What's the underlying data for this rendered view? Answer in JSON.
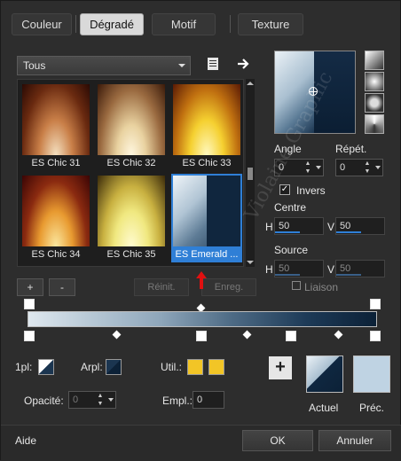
{
  "tabs": [
    {
      "label": "Couleur"
    },
    {
      "label": "Dégradé"
    },
    {
      "label": "Motif"
    },
    {
      "label": "Texture"
    }
  ],
  "category": {
    "selected": "Tous"
  },
  "gradients": [
    {
      "label": "ES Chic 31"
    },
    {
      "label": "ES Chic 32"
    },
    {
      "label": "ES Chic 33"
    },
    {
      "label": "ES Chic 34"
    },
    {
      "label": "ES Chic 35"
    },
    {
      "label": "ES Emerald ..."
    }
  ],
  "list_buttons": {
    "add": "+",
    "remove": "-",
    "reset": "Réinit.",
    "save": "Enreg."
  },
  "params": {
    "angle_label": "Angle",
    "angle_value": "0",
    "repeat_label": "Répét.",
    "repeat_value": "0",
    "invert_label": "Invers",
    "invert_checked": true,
    "centre_label": "Centre",
    "centre_h_label": "H",
    "centre_h": "50",
    "centre_v_label": "V",
    "centre_v": "50",
    "source_label": "Source",
    "source_h_label": "H",
    "source_h": "50",
    "source_v_label": "V",
    "source_v": "50",
    "link_label": "Liaison"
  },
  "stops": {
    "opl_label": "1pl:",
    "arpl_label": "Arpl:",
    "util_label": "Util.:",
    "opacity_label": "Opacité:",
    "opacity_value": "0",
    "empl_label": "Empl.:",
    "empl_value": "0"
  },
  "colors": {
    "accent": "#2f7fd6",
    "util_swatch": "#f2c526",
    "current_label": "Actuel",
    "previous_label": "Préc."
  },
  "footer": {
    "help": "Aide",
    "ok": "OK",
    "cancel": "Annuler"
  },
  "watermark": "Violaine Graphic"
}
